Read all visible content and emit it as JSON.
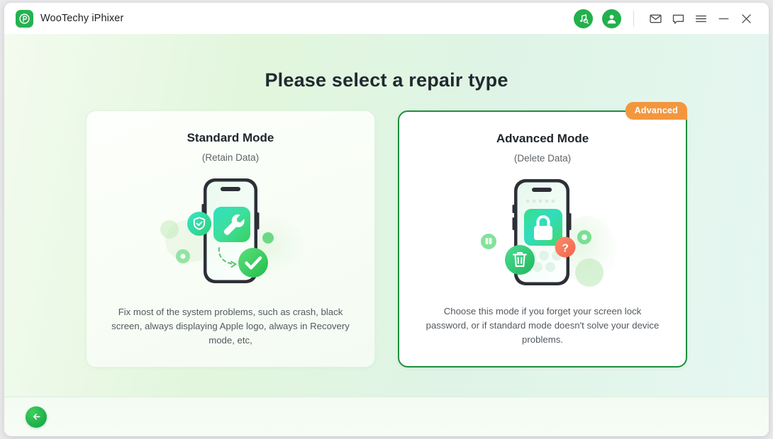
{
  "window": {
    "app_title": "WooTechy iPhixer",
    "logo_icon": "wootechy-p-logo",
    "toolbar_icons": [
      {
        "name": "music-search-icon",
        "label": "Music Search"
      },
      {
        "name": "user-account-icon",
        "label": "Account"
      },
      {
        "name": "mail-icon",
        "label": "Mail"
      },
      {
        "name": "chat-icon",
        "label": "Feedback"
      },
      {
        "name": "menu-icon",
        "label": "Menu"
      },
      {
        "name": "minimize-icon",
        "label": "Minimize"
      },
      {
        "name": "close-icon",
        "label": "Close"
      }
    ]
  },
  "main": {
    "page_title": "Please select a repair type",
    "cards": [
      {
        "title": "Standard Mode",
        "subtitle": "(Retain Data)",
        "description": "Fix most of the system problems, such as crash, black screen, always displaying Apple logo, always in Recovery mode, etc,",
        "badge": "",
        "selected": false,
        "illustration": "phone-wrench-shield-check"
      },
      {
        "title": "Advanced Mode",
        "subtitle": "(Delete Data)",
        "description": "Choose this mode if you forget your screen lock password, or if standard mode doesn't solve your device problems.",
        "badge": "Advanced",
        "selected": true,
        "illustration": "phone-lock-trash-question"
      }
    ]
  },
  "footer": {
    "back_label": "Back",
    "back_icon": "arrow-left-icon"
  },
  "colors": {
    "brand_green": "#22b14c",
    "selected_border": "#1f8f3c",
    "badge_orange": "#f2973f",
    "title_text": "#222930",
    "body_text": "#53595f"
  }
}
